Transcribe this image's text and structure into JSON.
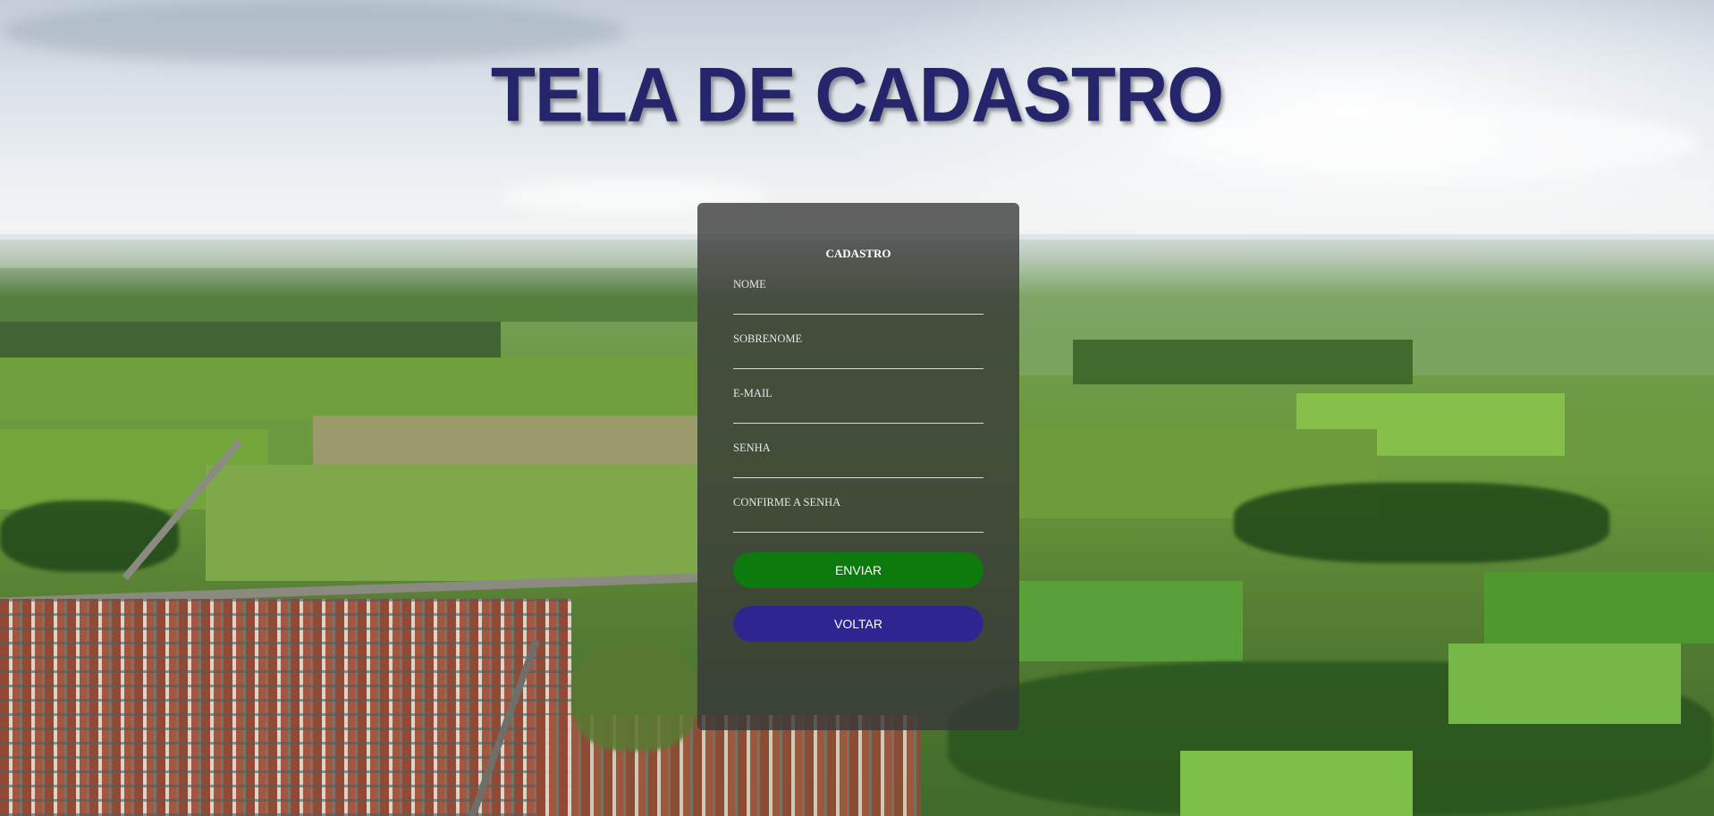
{
  "page": {
    "title": "TELA DE CADASTRO"
  },
  "form": {
    "heading": "CADASTRO",
    "fields": [
      {
        "label": "NOME",
        "value": ""
      },
      {
        "label": "SOBRENOME",
        "value": ""
      },
      {
        "label": "E-MAIL",
        "value": ""
      },
      {
        "label": "SENHA",
        "value": ""
      },
      {
        "label": "CONFIRME A SENHA",
        "value": ""
      }
    ],
    "submit_label": "ENVIAR",
    "back_label": "VOLTAR"
  },
  "colors": {
    "title": "#24256b",
    "panel": "rgba(55,55,55,0.78)",
    "submit_button": "#0d7a0d",
    "back_button": "#2f2590"
  }
}
